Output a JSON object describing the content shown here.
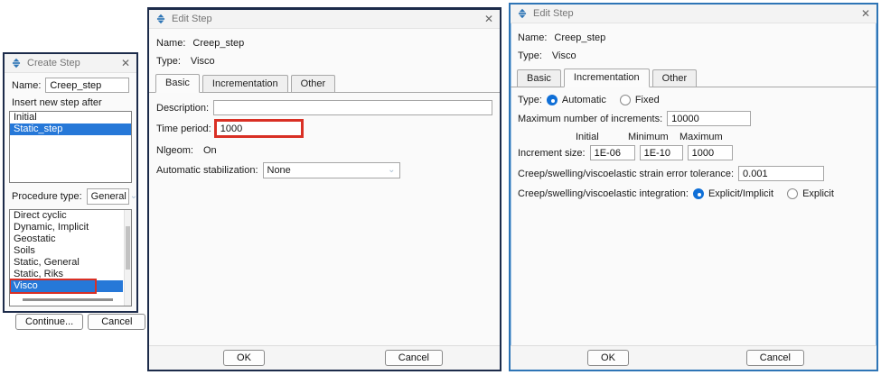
{
  "icons": {
    "app": "abaqus-logo",
    "close": "✕",
    "dropdown": "⌄"
  },
  "colors": {
    "selection_blue": "#2678d8",
    "highlight_red": "#d93025",
    "dialog_border_dark": "#1c2b4a",
    "dialog_border_blue": "#2e75b6",
    "radio_blue": "#0f6fd7"
  },
  "create_step": {
    "title": "Create Step",
    "name_label": "Name:",
    "name_value": "Creep_step",
    "insert_label": "Insert new step after",
    "steps": [
      "Initial",
      "Static_step"
    ],
    "selected_step": "Static_step",
    "procedure_type_label": "Procedure type:",
    "procedure_type_value": "General",
    "procedures": [
      "Direct cyclic",
      "Dynamic, Implicit",
      "Geostatic",
      "Soils",
      "Static, General",
      "Static, Riks",
      "Visco"
    ],
    "selected_procedure": "Visco",
    "continue_label": "Continue...",
    "cancel_label": "Cancel"
  },
  "edit_step_basic": {
    "title": "Edit Step",
    "name_label": "Name:",
    "name_value": "Creep_step",
    "type_label": "Type:",
    "type_value": "Visco",
    "tabs": [
      "Basic",
      "Incrementation",
      "Other"
    ],
    "active_tab": "Basic",
    "description_label": "Description:",
    "description_value": "",
    "time_period_label": "Time period:",
    "time_period_value": "1000",
    "nlgeom_label": "Nlgeom:",
    "nlgeom_value": "On",
    "stabilization_label": "Automatic stabilization:",
    "stabilization_value": "None",
    "ok_label": "OK",
    "cancel_label": "Cancel"
  },
  "edit_step_incrementation": {
    "title": "Edit Step",
    "name_label": "Name:",
    "name_value": "Creep_step",
    "type_label": "Type:",
    "type_value": "Visco",
    "tabs": [
      "Basic",
      "Incrementation",
      "Other"
    ],
    "active_tab": "Incrementation",
    "type_row_label": "Type:",
    "radio_automatic_label": "Automatic",
    "radio_fixed_label": "Fixed",
    "selected_type": "Automatic",
    "max_increments_label": "Maximum number of increments:",
    "max_increments_value": "10000",
    "col_initial": "Initial",
    "col_minimum": "Minimum",
    "col_maximum": "Maximum",
    "increment_size_label": "Increment size:",
    "increment_initial_value": "1E-06",
    "increment_minimum_value": "1E-10",
    "increment_maximum_value": "1000",
    "tolerance_label": "Creep/swelling/viscoelastic strain error tolerance:",
    "tolerance_value": "0.001",
    "integration_label": "Creep/swelling/viscoelastic integration:",
    "radio_explicit_implicit_label": "Explicit/Implicit",
    "radio_explicit_label": "Explicit",
    "selected_integration": "Explicit/Implicit",
    "ok_label": "OK",
    "cancel_label": "Cancel"
  }
}
